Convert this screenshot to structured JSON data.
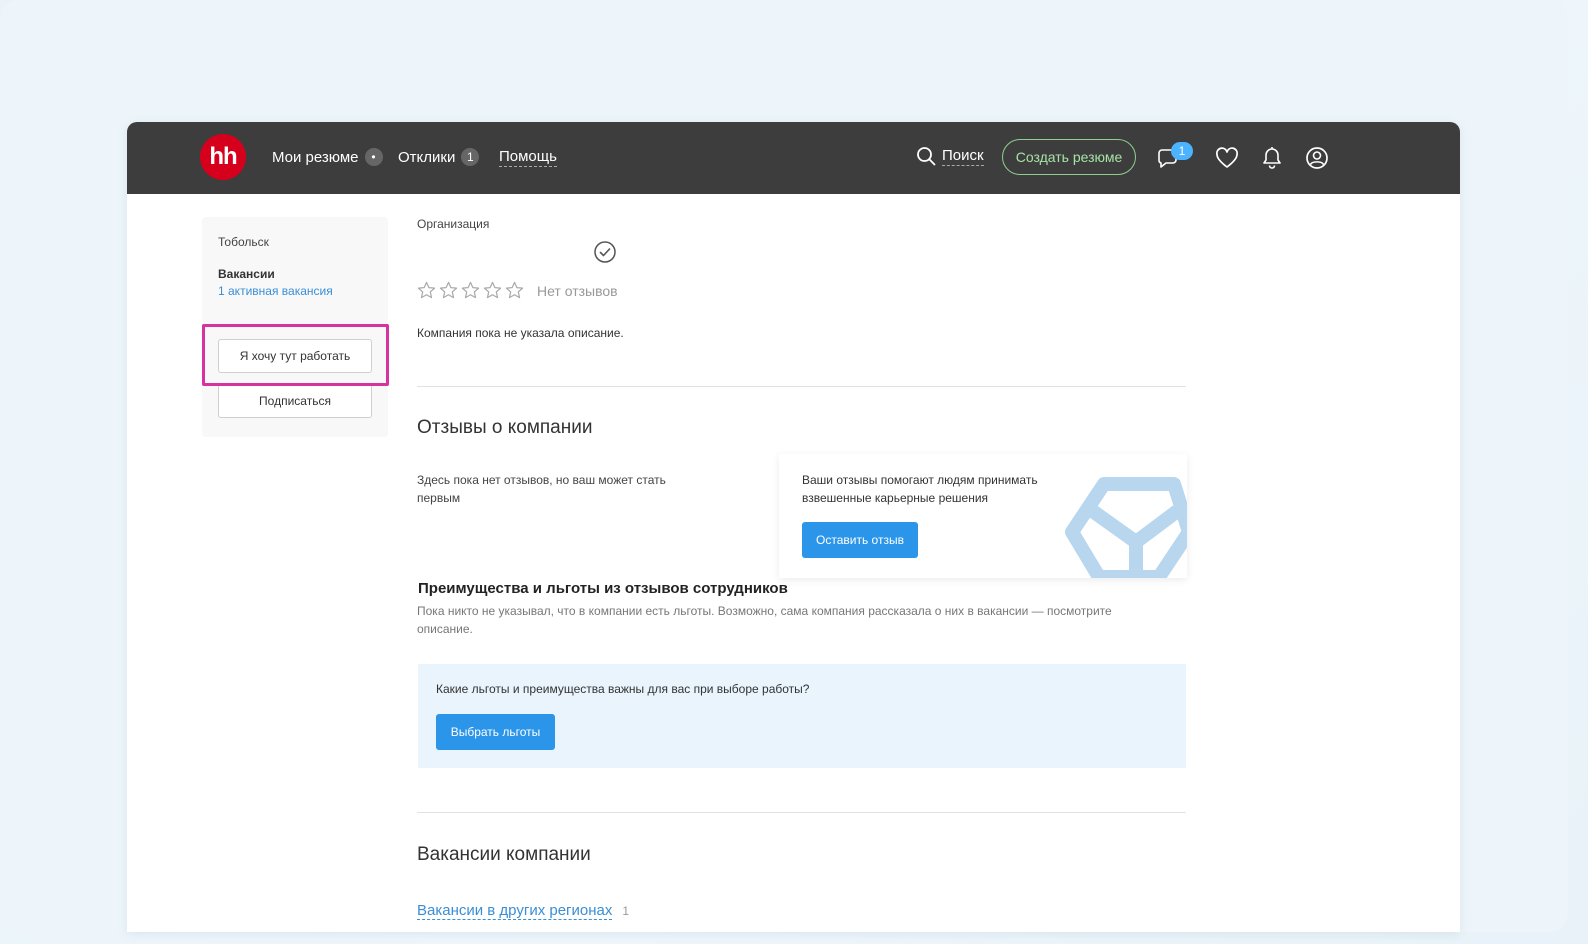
{
  "colors": {
    "header_bg": "#3d3d3d",
    "brand_red": "#d6001c",
    "create_green": "#a6e3a6",
    "primary_blue": "#2b95e9",
    "link_blue": "#3a8ed6",
    "highlight_pink": "#d6339e",
    "benefits_bg": "#e9f4fc"
  },
  "header": {
    "logo_text": "hh",
    "nav": [
      {
        "label": "Мои резюме",
        "badge": "•"
      },
      {
        "label": "Отклики",
        "badge": "1"
      },
      {
        "label": "Помощь"
      }
    ],
    "search_label": "Поиск",
    "create_button": "Создать резюме",
    "chat_badge": "1",
    "icons": [
      "search-icon",
      "chat-icon",
      "heart-icon",
      "bell-icon",
      "profile-icon"
    ]
  },
  "sidebar": {
    "city": "Тобольск",
    "vacancies_title": "Вакансии",
    "active_vacancies_link": "1 активная вакансия",
    "want_work_button": "Я хочу тут работать",
    "subscribe_button": "Подписаться"
  },
  "main": {
    "org_label": "Организация",
    "no_reviews": "Нет отзывов",
    "rating_stars": 0,
    "description": "Компания пока не указала описание.",
    "reviews_heading": "Отзывы о компании",
    "reviews_empty_text": "Здесь пока нет отзывов, но ваш может стать первым",
    "review_card_text": "Ваши отзывы помогают людям принимать взвешенные карьерные решения",
    "leave_review_button": "Оставить отзыв",
    "benefits_heading": "Преимущества и льготы из отзывов сотрудников",
    "benefits_text": "Пока никто не указывал, что в компании есть льготы. Возможно, сама компания рассказала о них в вакансии — посмотрите описание.",
    "benefits_question": "Какие льготы и преимущества важны для вас при выборе работы?",
    "choose_benefits_button": "Выбрать льготы",
    "vacancies_heading": "Вакансии компании",
    "other_regions_link": "Вакансии в других регионах",
    "other_regions_count": "1"
  }
}
